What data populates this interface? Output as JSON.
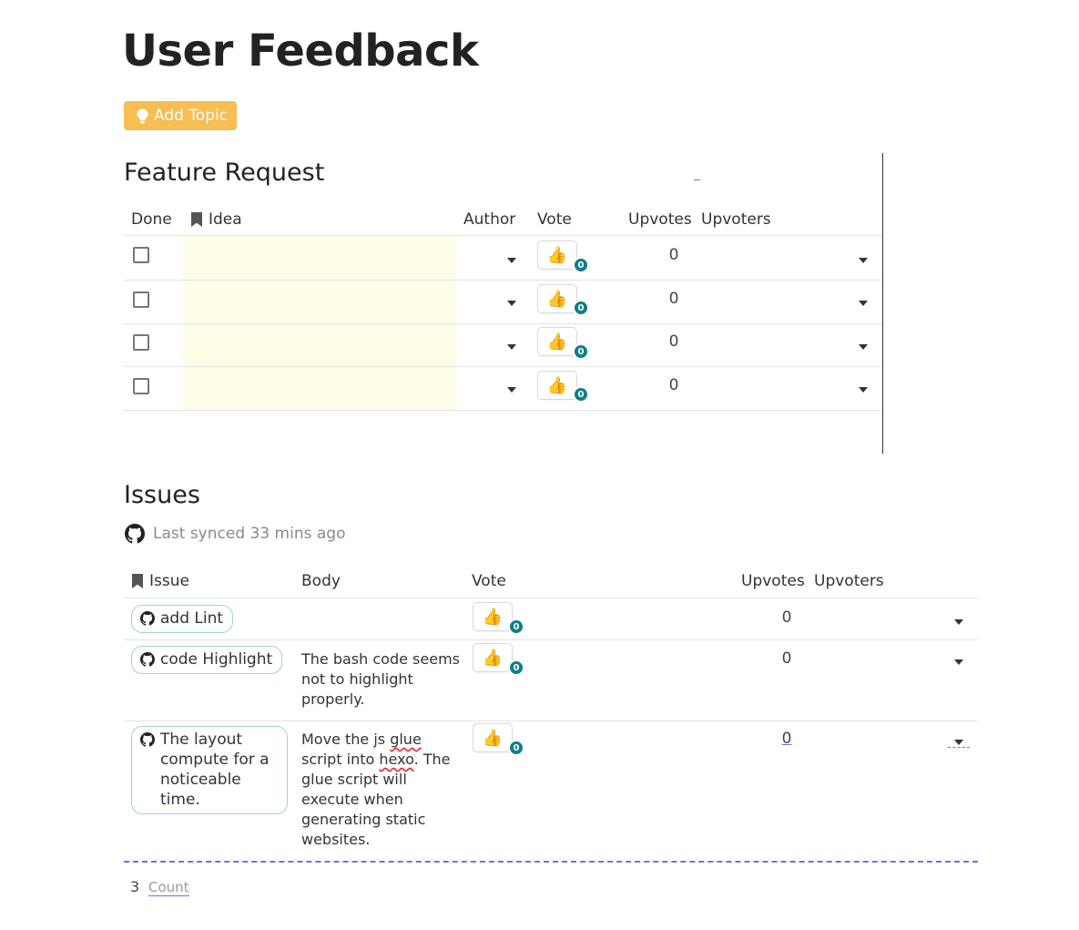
{
  "page": {
    "title": "User Feedback"
  },
  "toolbar": {
    "add_topic_label": "Add Topic"
  },
  "feature_request": {
    "title": "Feature Request",
    "columns": {
      "done": "Done",
      "idea": "Idea",
      "author": "Author",
      "vote": "Vote",
      "upvotes": "Upvotes",
      "upvoters": "Upvoters"
    },
    "rows": [
      {
        "done": false,
        "idea": "",
        "author": "",
        "vote_count": "0",
        "upvotes": "0"
      },
      {
        "done": false,
        "idea": "",
        "author": "",
        "vote_count": "0",
        "upvotes": "0"
      },
      {
        "done": false,
        "idea": "",
        "author": "",
        "vote_count": "0",
        "upvotes": "0"
      },
      {
        "done": false,
        "idea": "",
        "author": "",
        "vote_count": "0",
        "upvotes": "0"
      }
    ]
  },
  "issues": {
    "title": "Issues",
    "synced_text": "Last synced 33 mins ago",
    "columns": {
      "issue": "Issue",
      "body": "Body",
      "vote": "Vote",
      "upvotes": "Upvotes",
      "upvoters": "Upvoters"
    },
    "rows": [
      {
        "issue": "add Lint",
        "body": "",
        "vote_count": "0",
        "upvotes": "0"
      },
      {
        "issue": "code Highlight",
        "body": "The bash code seems not to highlight properly.",
        "vote_count": "0",
        "upvotes": "0"
      },
      {
        "issue": "The layout compute for a noticeable time.",
        "body_parts": [
          "Move the js ",
          "glue",
          " script into ",
          "hexo",
          ". The glue script will execute when generating static websites."
        ],
        "vote_count": "0",
        "upvotes": "0"
      }
    ],
    "footer": {
      "count_value": "3",
      "count_label": "Count"
    }
  },
  "icons": {
    "add_topic": "lightbulb-icon",
    "issue": "github-icon",
    "idea_header": "bookmark-icon",
    "vote": "thumbs-up-icon"
  },
  "colors": {
    "add_topic_bg": "#f6be53",
    "vote_badge": "#0f7e86",
    "issue_chip_border": "#9fd3db",
    "idea_highlight": "#fffce8",
    "dashed_accent": "#7b6cd9"
  }
}
